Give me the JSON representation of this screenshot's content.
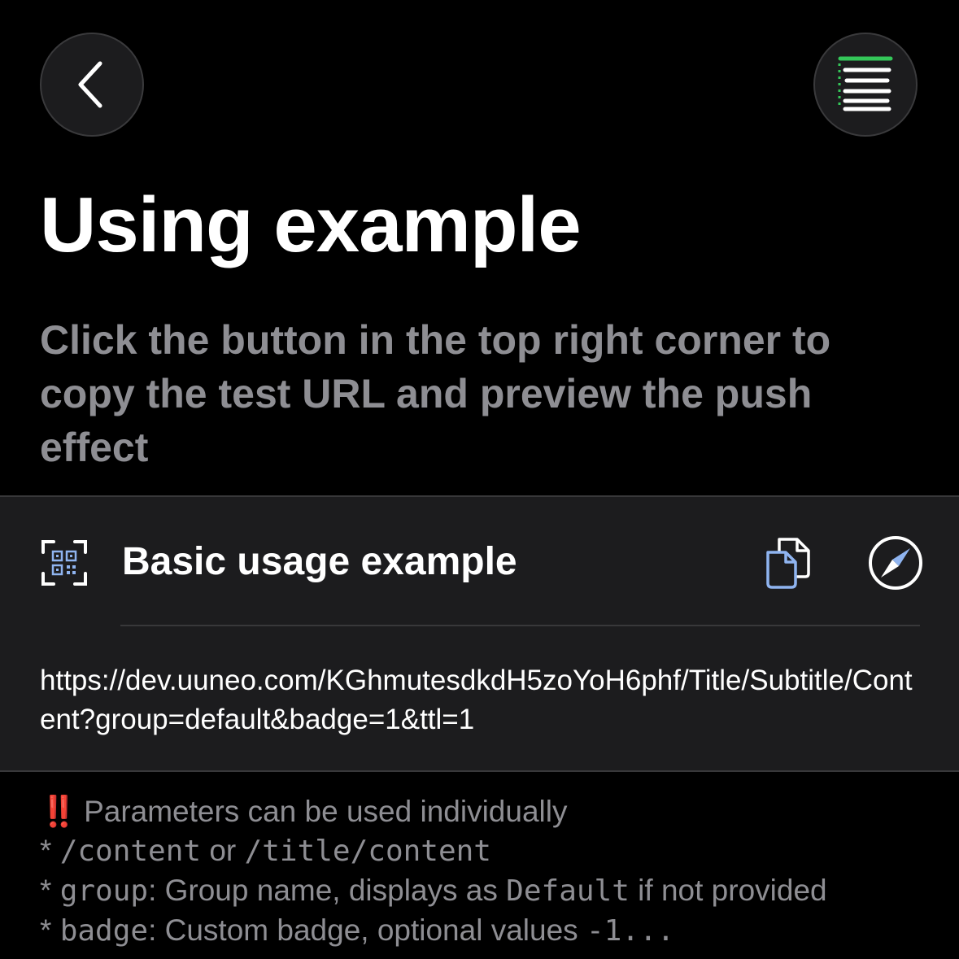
{
  "header": {
    "back_icon": "chevron-left-icon",
    "menu_icon": "list-icon",
    "accent_color": "#34c759"
  },
  "page": {
    "title": "Using example",
    "description": "Click the button in the top right corner to copy the test URL and preview the push effect"
  },
  "card": {
    "title": "Basic usage example",
    "qr_icon": "qr-scan-icon",
    "copy_icon": "copy-icon",
    "safari_icon": "compass-icon",
    "icon_color": "#8fb4f0",
    "url": "https://dev.uuneo.com/KGhmutesdkdH5zoYoH6phf/Title/Subtitle/Content?group=default&badge=1&ttl=1"
  },
  "notes": {
    "warning_icon": "‼️",
    "intro": "Parameters can be used individually",
    "lines": [
      {
        "bullet": "* ",
        "code": "/content",
        "text": " or ",
        "code2": "/title/content"
      },
      {
        "bullet": "* ",
        "code": "group",
        "text": ": Group name, displays as ",
        "code2": "Default",
        "text2": " if not provided"
      },
      {
        "bullet": "* ",
        "code": "badge",
        "text": ": Custom badge, optional values ",
        "code2": "-1..."
      }
    ]
  }
}
